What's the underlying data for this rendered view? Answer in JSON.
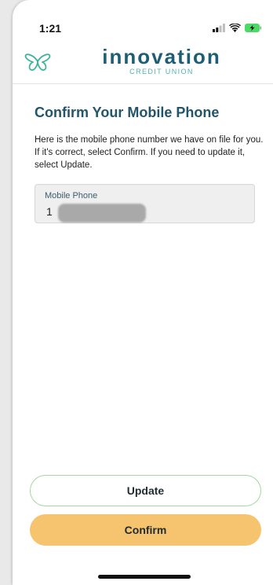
{
  "status_bar": {
    "time": "1:21",
    "icons": [
      "signal-icon",
      "wifi-icon",
      "battery-charging-icon"
    ]
  },
  "header": {
    "logo_icon": "butterfly-icon",
    "brand_name": "innovation",
    "brand_subtitle": "CREDIT UNION"
  },
  "page": {
    "title": "Confirm Your Mobile Phone",
    "description": "Here is the mobile phone number we have on file for you. If it's correct, select Confirm. If you need to update it, select Update."
  },
  "phone_field": {
    "label": "Mobile Phone",
    "value_prefix": "1"
  },
  "buttons": {
    "update_label": "Update",
    "confirm_label": "Confirm"
  },
  "colors": {
    "brand_dark": "#1e5e75",
    "brand_light": "#52b3a7",
    "confirm_bg": "#f6c36f",
    "update_border": "#a4d6a6"
  }
}
